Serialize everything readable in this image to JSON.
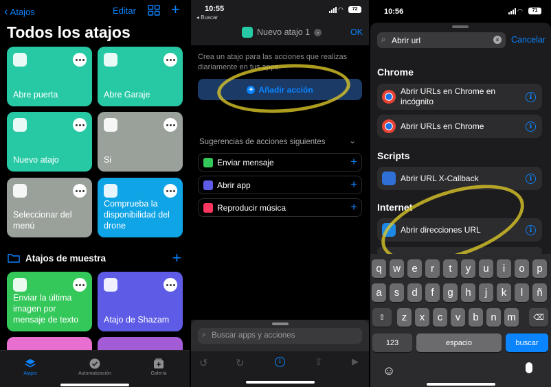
{
  "p1": {
    "back_label": "Atajos",
    "edit_label": "Editar",
    "title": "Todos los atajos",
    "tiles": [
      {
        "label": "Abre puerta",
        "color": "#27c9a5",
        "icon": "safari-icon"
      },
      {
        "label": "Abre Garaje",
        "color": "#27c9a5",
        "icon": "safari-icon"
      },
      {
        "label": "Nuevo atajo",
        "color": "#27c9a5",
        "icon": "layers-icon"
      },
      {
        "label": "Si",
        "color": "#9aa19b",
        "icon": "layers-icon"
      },
      {
        "label": "Seleccionar del menú",
        "color": "#9aa19b",
        "icon": "spinner-icon"
      },
      {
        "label": "Comprueba la disponibilidad del drone",
        "color": "#0fa4e6",
        "icon": "app-icon"
      },
      {
        "label": "Enviar la última imagen por mensaje de texto",
        "color": "#34c759",
        "icon": "message-icon"
      },
      {
        "label": "Atajo de Shazam",
        "color": "#5e5ce6",
        "icon": "waveform-icon"
      }
    ],
    "folder_label": "Atajos de muestra",
    "tabs": [
      "Atajos",
      "Automatización",
      "Galería"
    ]
  },
  "p2": {
    "time": "10:55",
    "back_label": "◂ Buscar",
    "battery": "72",
    "shortcut_name": "Nuevo atajo 1",
    "ok_label": "OK",
    "intro": "Crea un atajo para las acciones que realizas diariamente en tus apps.",
    "add_action": "Añadir acción",
    "suggestions_title": "Sugerencias de acciones siguientes",
    "suggestions": [
      {
        "label": "Enviar mensaje",
        "color": "#34c759"
      },
      {
        "label": "Abrir app",
        "color": "#5e5ce6"
      },
      {
        "label": "Reproducir música",
        "color": "#ff375f"
      }
    ],
    "search_placeholder": "Buscar apps y acciones"
  },
  "p3": {
    "time": "10:56",
    "battery": "71",
    "search_value": "Abrir url",
    "cancel_label": "Cancelar",
    "sections": [
      {
        "title": "Chrome",
        "rows": [
          {
            "label": "Abrir URLs en Chrome en incógnito",
            "icon": "chrome-icon"
          },
          {
            "label": "Abrir URLs en Chrome",
            "icon": "chrome-icon"
          }
        ]
      },
      {
        "title": "Scripts",
        "rows": [
          {
            "label": "Abrir URL X-Callback",
            "icon": "scripts-icon"
          }
        ]
      },
      {
        "title": "Internet",
        "rows": [
          {
            "label": "Abrir direcciones URL",
            "icon": "safari-icon"
          }
        ]
      }
    ],
    "keyboard": {
      "row1": [
        "q",
        "w",
        "e",
        "r",
        "t",
        "y",
        "u",
        "i",
        "o",
        "p"
      ],
      "row2": [
        "a",
        "s",
        "d",
        "f",
        "g",
        "h",
        "j",
        "k",
        "l",
        "ñ"
      ],
      "row3": [
        "z",
        "x",
        "c",
        "v",
        "b",
        "n",
        "m"
      ],
      "num_label": "123",
      "space_label": "espacio",
      "search_label": "buscar"
    }
  }
}
